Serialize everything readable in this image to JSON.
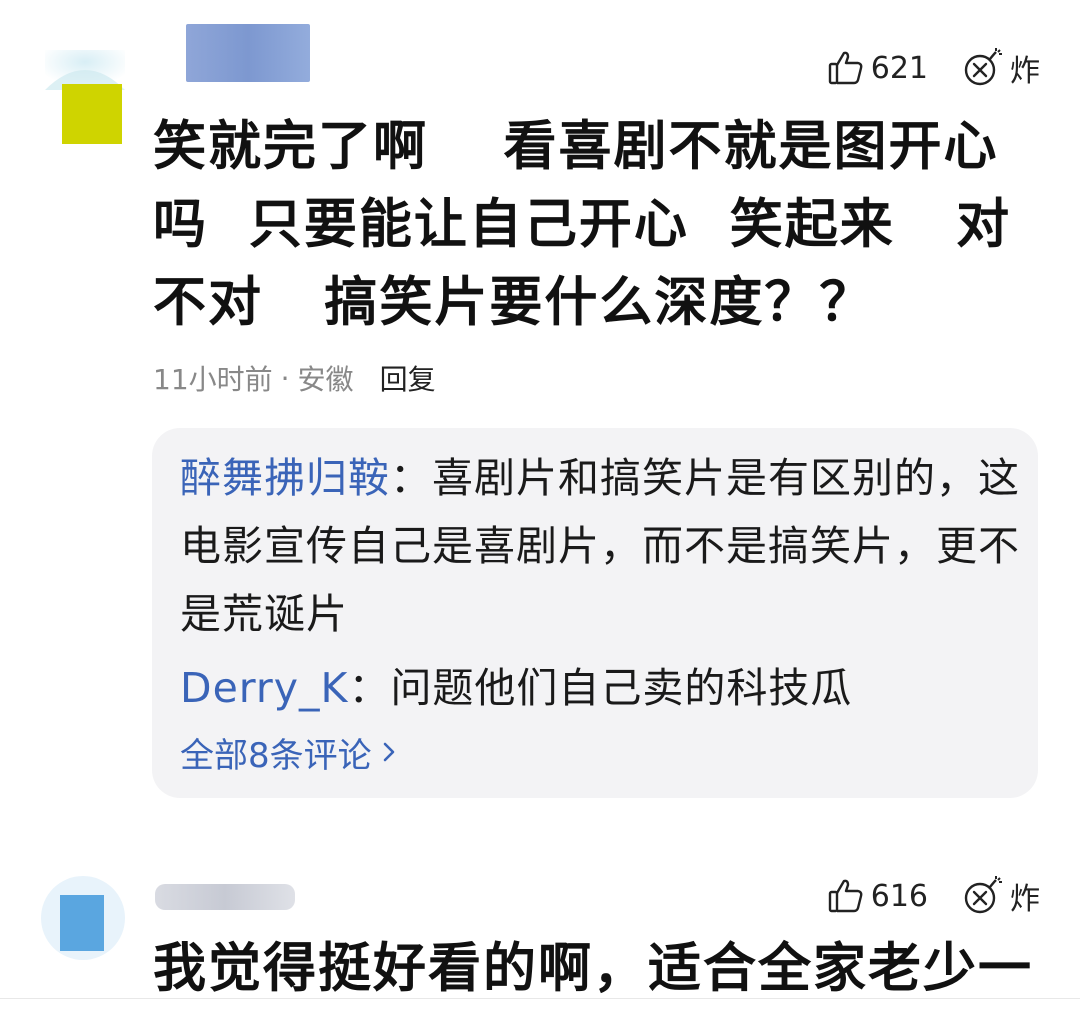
{
  "comments": [
    {
      "likes": "621",
      "bomb_label": "炸",
      "text": "笑就完了啊　 看喜剧不就是图开心吗  只要能让自己开心  笑起来   对不对   搞笑片要什么深度？？",
      "time": "11小时前",
      "separator": "·",
      "location": "安徽",
      "reply_label": "回复",
      "replies": [
        {
          "name": "醉舞拂归鞍",
          "colon": "：",
          "text": "喜剧片和搞笑片是有区别的，这电影宣传自己是喜剧片，而不是搞笑片，更不是荒诞片"
        },
        {
          "name": "Derry_K",
          "colon": "：",
          "text": "问题他们自己卖的科技瓜"
        }
      ],
      "all_comments": "全部8条评论",
      "all_comments_icon": "chevron-right-icon"
    },
    {
      "likes": "616",
      "bomb_label": "炸",
      "text": "我觉得挺好看的啊，适合全家老少一"
    }
  ],
  "colors": {
    "link_blue": "#3a64b8",
    "reply_bg": "#f3f3f5",
    "meta_gray": "#888888"
  }
}
